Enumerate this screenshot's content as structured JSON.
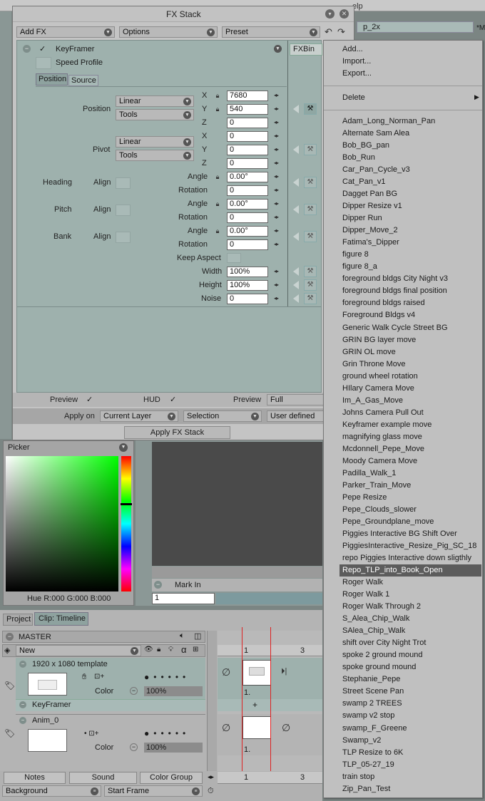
{
  "menubar_fragment": "elp",
  "bg_tab": {
    "label": "p_2x",
    "right_label": "*M"
  },
  "fxstack": {
    "title": "FX Stack",
    "toolbar": {
      "add_fx": "Add FX",
      "options": "Options",
      "preset": "Preset"
    },
    "effect": {
      "name": "KeyFramer",
      "profile": "Speed Profile",
      "fxbin": "FXBin"
    },
    "tabs": {
      "position": "Position",
      "source": "Source"
    },
    "position": {
      "label": "Position",
      "interp": "Linear",
      "tools": "Tools",
      "x": "7680",
      "y": "540",
      "z": "0"
    },
    "pivot": {
      "label": "Pivot",
      "interp": "Linear",
      "tools": "Tools",
      "x": "0",
      "y": "0",
      "z": "0"
    },
    "axis": {
      "x": "X",
      "y": "Y",
      "z": "Z"
    },
    "heading": {
      "label": "Heading",
      "align": "Align",
      "angle_label": "Angle",
      "angle": "0.00°",
      "rotation_label": "Rotation",
      "rotation": "0"
    },
    "pitch": {
      "label": "Pitch",
      "align": "Align",
      "angle_label": "Angle",
      "angle": "0.00°",
      "rotation_label": "Rotation",
      "rotation": "0"
    },
    "bank": {
      "label": "Bank",
      "align": "Align",
      "angle_label": "Angle",
      "angle": "0.00°",
      "rotation_label": "Rotation",
      "rotation": "0"
    },
    "keep_aspect": "Keep Aspect",
    "width": {
      "label": "Width",
      "value": "100%"
    },
    "height": {
      "label": "Height",
      "value": "100%"
    },
    "noise": {
      "label": "Noise",
      "value": "0"
    },
    "footer": {
      "preview1": "Preview",
      "hud": "HUD",
      "preview2": "Preview",
      "preview_mode": "Full",
      "apply_on": "Apply on",
      "layer": "Current Layer",
      "selection": "Selection",
      "user_defined": "User defined",
      "apply_btn": "Apply FX Stack"
    }
  },
  "picker": {
    "title": "Picker",
    "hue_readout": "Hue R:000 G:000 B:000"
  },
  "viewer": {
    "mark_in": "Mark In",
    "frame": "1"
  },
  "timeline": {
    "tabs": {
      "project": "Project",
      "clip": "Clip: Timeline"
    },
    "master": "MASTER",
    "layer_mode": "New",
    "frame_num": "1",
    "frame_num2": "3",
    "layers": [
      {
        "name": "1920 x 1080 template",
        "color_label": "Color",
        "opacity": "100%",
        "fx": "KeyFramer",
        "frame": "1."
      },
      {
        "name": "Anim_0",
        "color_label": "Color",
        "opacity": "100%",
        "frame": "1."
      }
    ],
    "bottom_tabs": {
      "notes": "Notes",
      "sound": "Sound",
      "color_group": "Color Group"
    },
    "background": "Background",
    "start_frame": "Start Frame"
  },
  "menu": {
    "top_items": [
      "Add...",
      "Import...",
      "Export..."
    ],
    "delete": "Delete",
    "presets": [
      "Adam_Long_Norman_Pan",
      "Alternate Sam Alea",
      "Bob_BG_pan",
      "Bob_Run",
      "Car_Pan_Cycle_v3",
      "Cat_Pan_v1",
      "Dagget Pan BG",
      "Dipper Resize v1",
      "Dipper Run",
      "Dipper_Move_2",
      "Fatima's_Dipper",
      "figure 8",
      "figure 8_a",
      "foreground bldgs City Night v3",
      "foreground bldgs final position",
      "foreground bldgs raised",
      "Foreground Bldgs v4",
      "Generic Walk Cycle Street BG",
      "GRIN BG layer move",
      "GRIN OL move",
      "Grin Throne Move",
      "ground wheel rotation",
      "HIlary Camera Move",
      "Im_A_Gas_Move",
      "Johns Camera Pull Out",
      "Keyframer example move",
      "magnifying glass move",
      "Mcdonnell_Pepe_Move",
      "Moody Camera Move",
      "Padilla_Walk_1",
      "Parker_Train_Move",
      "Pepe Resize",
      "Pepe_Clouds_slower",
      "Pepe_Groundplane_move",
      "Piggies Interactive  BG Shift Over",
      "PiggiesInteractive_Resize_Pig_SC_18",
      "repo Piggies Interactive down sligthly",
      "Repo_TLP_into_Book_Open",
      "Roger Walk",
      "Roger Walk 1",
      "Roger Walk Through 2",
      "S_Alea_Chip_Walk",
      "SAlea_Chip_Walk",
      "shift over City Night Trot",
      "spoke 2 ground mound",
      "spoke ground mound",
      "Stephanie_Pepe",
      "Street Scene Pan",
      "swamp 2 TREES",
      "swamp v2 stop",
      "swamp_F_Greene",
      "Swamp_v2",
      "TLP Resize to 6K",
      "TLP_05-27_19",
      "train stop",
      "Zip_Pan_Test"
    ],
    "selected_index": 37
  }
}
